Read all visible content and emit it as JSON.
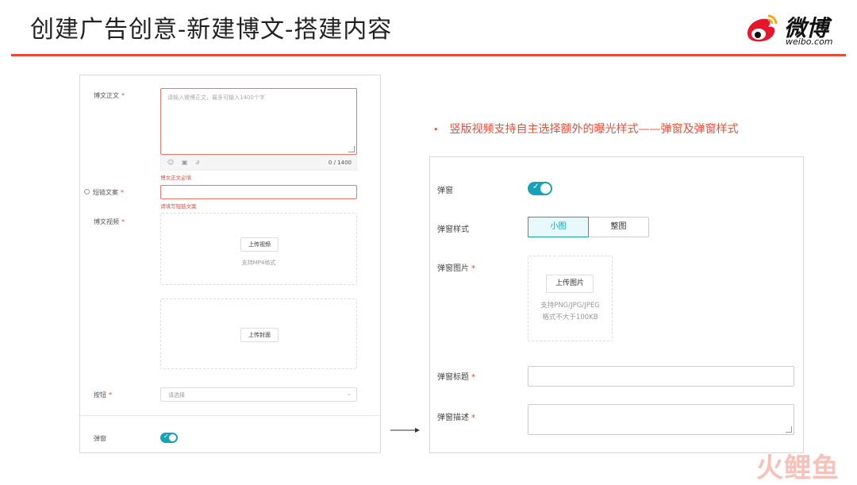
{
  "header": {
    "title": "创建广告创意-新建博文-搭建内容",
    "logo_text": "微博",
    "logo_sub": "weibo.com"
  },
  "left_form": {
    "body": {
      "label": "博文正文",
      "placeholder": "请输入微博正文，最多可输入1400个字",
      "counter": "0 / 1400",
      "error": "博文正文必填"
    },
    "short_link": {
      "label": "短链文案",
      "error": "请填写短链文案"
    },
    "video": {
      "label": "博文视频",
      "upload_button": "上传视频",
      "hint": "支持MP4格式"
    },
    "cover": {
      "upload_button": "上传封面"
    },
    "button": {
      "label": "按钮",
      "placeholder": "请选择"
    },
    "popup": {
      "label": "弹窗",
      "toggle_on": true
    }
  },
  "bullet_note": "竖版视频支持自主选择额外的曝光样式——弹窗及弹窗样式",
  "right_form": {
    "popup_label": "弹窗",
    "popup_on": true,
    "style": {
      "label": "弹窗样式",
      "options": [
        "小图",
        "整图"
      ],
      "selected": "小图"
    },
    "image": {
      "label": "弹窗图片",
      "upload_button": "上传图片",
      "hint_line1": "支持PNG/JPG/JPEG",
      "hint_line2": "格式不大于100KB"
    },
    "title": {
      "label": "弹窗标题"
    },
    "desc": {
      "label": "弹窗描述"
    }
  },
  "watermark": "火鲤鱼",
  "colors": {
    "accent": "#17a2b8",
    "error": "#e8503a",
    "rule": "#e84b3c"
  }
}
